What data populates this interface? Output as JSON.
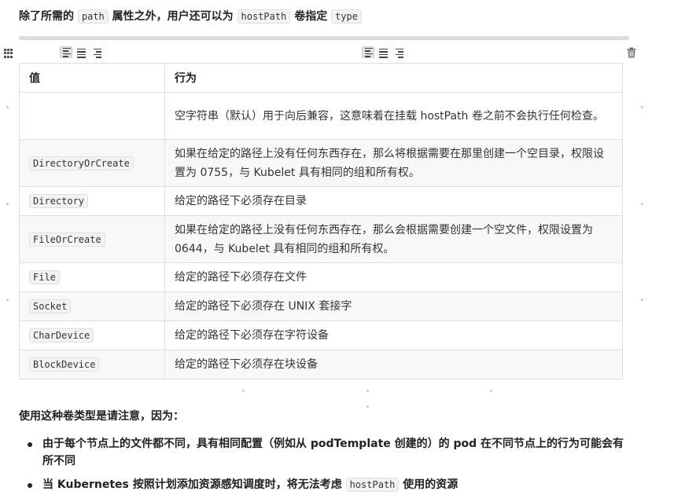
{
  "intro": {
    "pre": "除了所需的 ",
    "code1": "path",
    "mid": " 属性之外，用户还可以为 ",
    "code2": "hostPath",
    "mid2": " 卷指定 ",
    "code3": "type"
  },
  "table": {
    "headers": [
      "值",
      "行为"
    ],
    "rows": [
      {
        "value": "",
        "desc": "空字符串（默认）用于向后兼容，这意味着在挂载 hostPath 卷之前不会执行任何检查。"
      },
      {
        "value": "DirectoryOrCreate",
        "desc": "如果在给定的路径上没有任何东西存在，那么将根据需要在那里创建一个空目录，权限设置为 0755，与 Kubelet 具有相同的组和所有权。"
      },
      {
        "value": "Directory",
        "desc": "给定的路径下必须存在目录"
      },
      {
        "value": "FileOrCreate",
        "desc": "如果在给定的路径上没有任何东西存在，那么会根据需要创建一个空文件，权限设置为 0644，与 Kubelet 具有相同的组和所有权。"
      },
      {
        "value": "File",
        "desc": "给定的路径下必须存在文件"
      },
      {
        "value": "Socket",
        "desc": "给定的路径下必须存在 UNIX 套接字"
      },
      {
        "value": "CharDevice",
        "desc": "给定的路径下必须存在字符设备"
      },
      {
        "value": "BlockDevice",
        "desc": "给定的路径下必须存在块设备"
      }
    ]
  },
  "notice": "使用这种卷类型是请注意，因为：",
  "bullets": [
    {
      "text": "由于每个节点上的文件都不同，具有相同配置（例如从 podTemplate 创建的）的 pod 在不同节点上的行为可能会有所不同"
    },
    {
      "pre": "当 Kubernetes 按照计划添加资源感知调度时，将无法考虑 ",
      "code": "hostPath",
      "post": " 使用的资源"
    }
  ],
  "icons": {
    "drag": "drag-handle-icon",
    "align_left": "align-left-icon",
    "align_center": "align-center-icon",
    "align_right": "align-right-icon",
    "delete": "trash-icon"
  }
}
